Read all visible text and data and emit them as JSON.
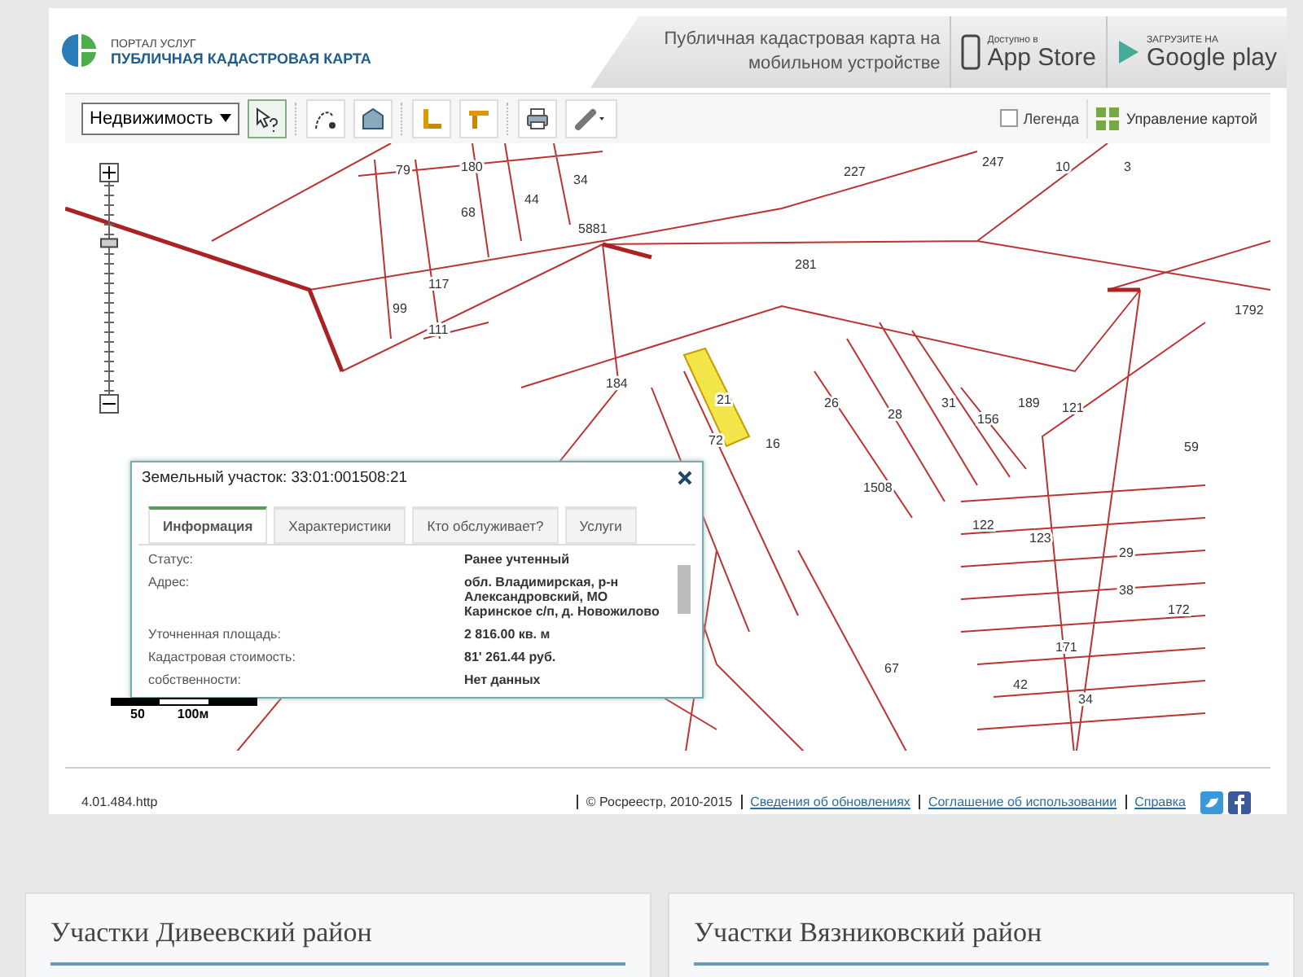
{
  "header": {
    "portal": "ПОРТАЛ УСЛУГ",
    "title": "ПУБЛИЧНАЯ КАДАСТРОВАЯ КАРТА",
    "promo": "Публичная кадастровая карта на мобильном устройстве",
    "stores": [
      {
        "kind": "apple",
        "small": "Доступно в",
        "big": "App Store"
      },
      {
        "kind": "google",
        "small": "ЗАГРУЗИТЕ НА",
        "big": "Google play"
      }
    ]
  },
  "toolbar": {
    "layer_select": "Недвижимость",
    "tools": [
      {
        "kind": "cursor-query",
        "selected": true
      },
      {
        "kind": "path-query",
        "selected": false
      },
      {
        "kind": "building-query",
        "selected": false
      },
      {
        "kind": "ruler",
        "selected": false
      },
      {
        "kind": "area-ruler",
        "selected": false
      },
      {
        "kind": "print",
        "selected": false
      },
      {
        "kind": "link",
        "selected": false
      }
    ],
    "legend": {
      "label": "Легенда",
      "checked": false
    },
    "map_control": "Управление картой"
  },
  "map": {
    "labels": [
      "79",
      "180",
      "68",
      "44",
      "34",
      "5881",
      "227",
      "247",
      "10",
      "3",
      "1792",
      "281",
      "99",
      "117",
      "111",
      "184",
      "26",
      "28",
      "31",
      "156",
      "189",
      "121",
      "59",
      "1508",
      "122",
      "123",
      "29",
      "38",
      "172",
      "171",
      "42",
      "34",
      "67",
      "21",
      "72",
      "16"
    ],
    "zoom": {
      "level": 0.72
    },
    "scale": {
      "mid": "50",
      "end": "100м"
    },
    "popup": {
      "title": "Земельный участок: 33:01:001508:21",
      "tabs": [
        {
          "label": "Информация",
          "selected": true
        },
        {
          "label": "Характеристики",
          "selected": false
        },
        {
          "label": "Кто обслуживает?",
          "selected": false
        },
        {
          "label": "Услуги",
          "selected": false
        }
      ],
      "rows": [
        {
          "label": "Статус:",
          "value": "Ранее учтенный"
        },
        {
          "label": "Адрес:",
          "value": "обл. Владимирская, р-н Александровский, МО Каринское с/п, д. Новожилово"
        },
        {
          "label": "Уточненная площадь:",
          "value": "2 816.00 кв. м"
        },
        {
          "label": "Кадастровая стоимость:",
          "value": "81' 261.44 руб."
        },
        {
          "label": "собственности:",
          "value": "Нет данных"
        }
      ]
    }
  },
  "footer": {
    "version": "4.01.484.http",
    "copyright": "© Росреестр, 2010-2015",
    "links": [
      "Сведения об обновлениях",
      "Соглашение об использовании",
      "Справка"
    ]
  },
  "cards": [
    {
      "title": "Участки Дивеевский район"
    },
    {
      "title": "Участки Вязниковский район"
    }
  ]
}
